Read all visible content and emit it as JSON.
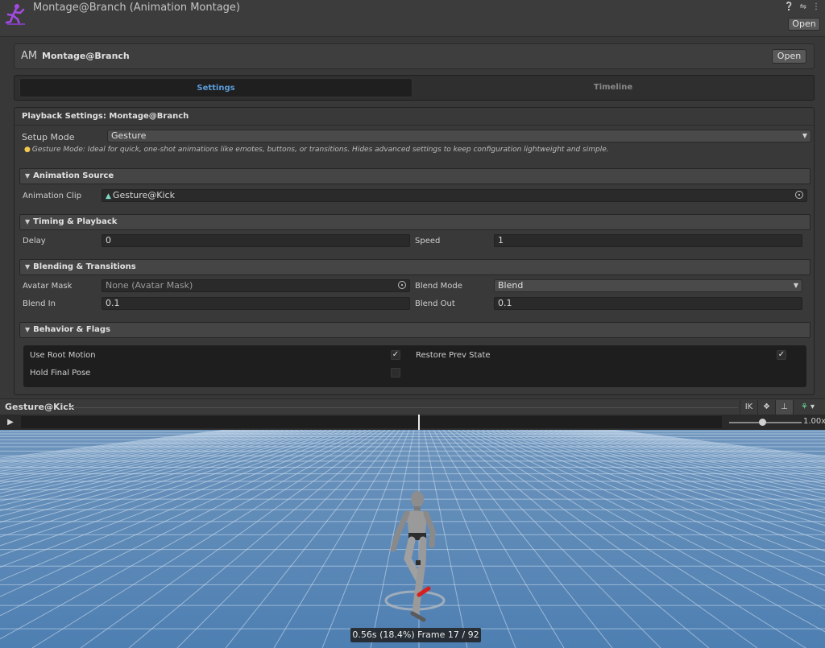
{
  "header": {
    "title": "Montage@Branch (Animation Montage)",
    "open_label": "Open",
    "icons": [
      "help-icon",
      "settings-sliders-icon",
      "more-options-icon"
    ]
  },
  "asset": {
    "icon_text": "AM",
    "name": "Montage@Branch",
    "open_label": "Open"
  },
  "tabs": [
    {
      "label": "Settings",
      "active": true
    },
    {
      "label": "Timeline",
      "active": false
    }
  ],
  "playback": {
    "title": "Playback Settings: Montage@Branch",
    "setup_mode_label": "Setup Mode",
    "setup_mode_value": "Gesture",
    "hint": "Gesture Mode: Ideal for quick, one-shot animations like emotes, buttons, or transitions. Hides advanced settings to keep configuration lightweight and simple."
  },
  "sections": {
    "source": {
      "title": "Animation Source",
      "clip_label": "Animation Clip",
      "clip_value": "Gesture@Kick"
    },
    "timing": {
      "title": "Timing & Playback",
      "delay_label": "Delay",
      "delay_value": "0",
      "speed_label": "Speed",
      "speed_value": "1"
    },
    "blending": {
      "title": "Blending & Transitions",
      "mask_label": "Avatar Mask",
      "mask_value": "None (Avatar Mask)",
      "blend_mode_label": "Blend Mode",
      "blend_mode_value": "Blend",
      "blend_in_label": "Blend In",
      "blend_in_value": "0.1",
      "blend_out_label": "Blend Out",
      "blend_out_value": "0.1"
    },
    "flags": {
      "title": "Behavior & Flags",
      "items": [
        {
          "label": "Use Root Motion",
          "checked": true
        },
        {
          "label": "Restore Prev State",
          "checked": true
        },
        {
          "label": "Hold Final Pose",
          "checked": false
        }
      ]
    }
  },
  "preview": {
    "clip_name": "Gesture@Kick",
    "ik_label": "IK",
    "speed_label": "1.00x",
    "frame_label": "0.56s (18.4%) Frame 17 / 92",
    "progress": 0.184,
    "colors": {
      "ground": "#5a88b8",
      "grid": "#cfe0f0",
      "sky": "#5e5e5e"
    }
  }
}
